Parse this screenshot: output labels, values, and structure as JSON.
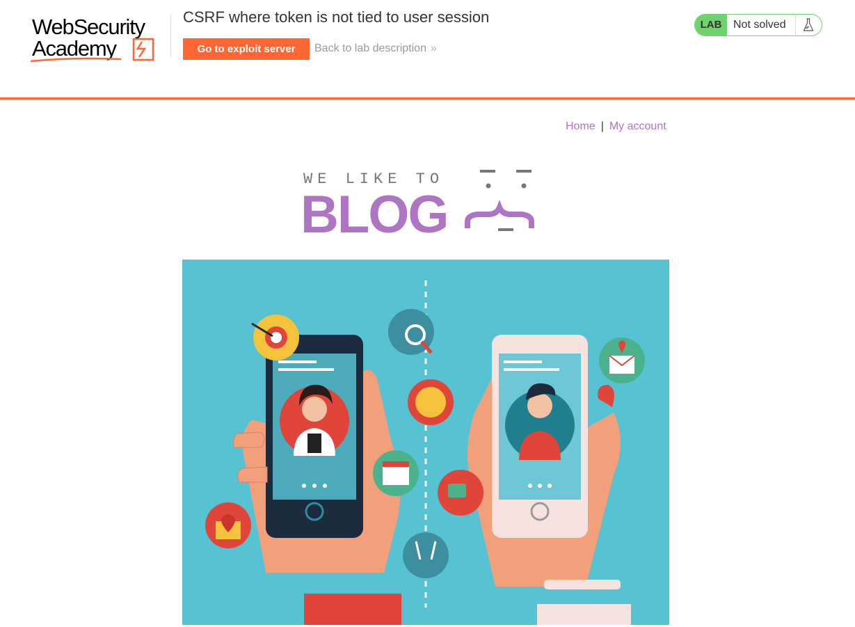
{
  "lab_header": {
    "logo_line1": "WebSecurity",
    "logo_line2": "Academy",
    "lab_title": "CSRF where token is not tied to user session",
    "exploit_button": "Go to exploit server",
    "back_link": "Back to lab description",
    "back_link_icon": "double-chevron-right",
    "status": {
      "badge": "LAB",
      "text": "Not solved",
      "icon": "flask-icon"
    }
  },
  "nav": {
    "home": "Home",
    "separator": "|",
    "account": "My account"
  },
  "banner": {
    "line1": "WE LIKE TO",
    "line2": "BLOG"
  },
  "hero": {
    "description": "illustration of two hands holding phones with dating app icons"
  },
  "colors": {
    "accent_orange": "#ff6633",
    "status_green": "#70d16d",
    "link_purple": "#ae75c5",
    "hero_bg": "#56c2d2"
  }
}
